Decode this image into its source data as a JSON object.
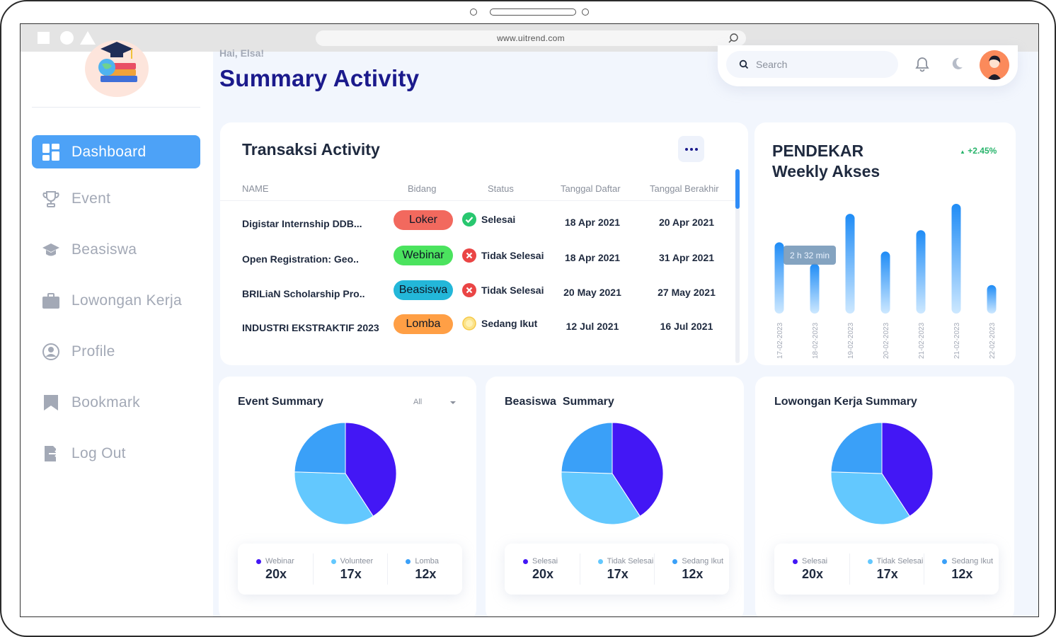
{
  "browser": {
    "url": "www.uitrend.com"
  },
  "sidebar": {
    "items": [
      {
        "label": "Dashboard",
        "icon": "dashboard-icon",
        "active": true
      },
      {
        "label": "Event",
        "icon": "trophy-icon"
      },
      {
        "label": "Beasiswa",
        "icon": "graduation-cap-icon"
      },
      {
        "label": "Lowongan Kerja",
        "icon": "briefcase-icon"
      },
      {
        "label": "Profile",
        "icon": "user-circle-icon"
      },
      {
        "label": "Bookmark",
        "icon": "bookmark-icon"
      },
      {
        "label": "Log Out",
        "icon": "logout-icon"
      }
    ]
  },
  "header": {
    "greeting": "Hai, Elsa!",
    "title": "Summary Activity",
    "search_placeholder": "Search"
  },
  "transactions": {
    "title": "Transaksi Activity",
    "columns": [
      "NAME",
      "Bidang",
      "Status",
      "Tanggal Daftar",
      "Tanggal Berakhir"
    ],
    "rows": [
      {
        "name": "Digistar Internship DDB...",
        "bidang": "Loker",
        "bidang_color": "#f2695e",
        "status": "Selesai",
        "status_type": "done",
        "daftar": "18 Apr 2021",
        "berakhir": "20 Apr 2021"
      },
      {
        "name": "Open Registration: Geo..",
        "bidang": "Webinar",
        "bidang_color": "#4be35e",
        "status": "Tidak Selesai",
        "status_type": "fail",
        "daftar": "18 Apr 2021",
        "berakhir": "31 Apr 2021"
      },
      {
        "name": "BRILiaN Scholarship Pro..",
        "bidang": "Beasiswa",
        "bidang_color": "#23b7d9",
        "status": "Tidak Selesai",
        "status_type": "fail",
        "daftar": "20 May 2021",
        "berakhir": "27 May 2021"
      },
      {
        "name": "INDUSTRI EKSTRAKTIF 2023",
        "bidang": "Lomba",
        "bidang_color": "#ff9f45",
        "status": "Sedang Ikut",
        "status_type": "ongoing",
        "daftar": "12 Jul 2021",
        "berakhir": "16 Jul 2021"
      }
    ]
  },
  "weekly": {
    "title_line1": "PENDEKAR",
    "title_line2": "Weekly Akses",
    "delta": "+2.45%",
    "tooltip": "2 h 32 min",
    "chart_data": {
      "type": "bar",
      "categories": [
        "17-02-2023",
        "18-02-2023",
        "19-02-2023",
        "20-02-2023",
        "21-02-2023",
        "21-02-2023",
        "22-02-2023"
      ],
      "values": [
        100,
        70,
        140,
        87,
        117,
        154,
        40
      ]
    }
  },
  "summaries": [
    {
      "title": "Event Summary",
      "filter": "All",
      "chart_data": {
        "type": "pie",
        "labels": [
          "Webinar",
          "Volunteer",
          "Lomba"
        ],
        "values": [
          20,
          17,
          12
        ],
        "colors": [
          "#4317f5",
          "#63c8fe",
          "#3aa0f8"
        ]
      },
      "legend": [
        {
          "label": "Webinar",
          "value": "20x"
        },
        {
          "label": "Volunteer",
          "value": "17x"
        },
        {
          "label": "Lomba",
          "value": "12x"
        }
      ]
    },
    {
      "title": "Beasiswa  Summary",
      "chart_data": {
        "type": "pie",
        "labels": [
          "Selesai",
          "Tidak Selesai",
          "Sedang Ikut"
        ],
        "values": [
          20,
          17,
          12
        ],
        "colors": [
          "#4317f5",
          "#63c8fe",
          "#3aa0f8"
        ]
      },
      "legend": [
        {
          "label": "Selesai",
          "value": "20x"
        },
        {
          "label": "Tidak Selesai",
          "value": "17x"
        },
        {
          "label": "Sedang Ikut",
          "value": "12x"
        }
      ]
    },
    {
      "title": "Lowongan Kerja Summary",
      "chart_data": {
        "type": "pie",
        "labels": [
          "Selesai",
          "Tidak Selesai",
          "Sedang Ikut"
        ],
        "values": [
          20,
          17,
          12
        ],
        "colors": [
          "#4317f5",
          "#63c8fe",
          "#3aa0f8"
        ]
      },
      "legend": [
        {
          "label": "Selesai",
          "value": "20x"
        },
        {
          "label": "Tidak Selesai",
          "value": "17x"
        },
        {
          "label": "Sedang Ikut",
          "value": "12x"
        }
      ]
    }
  ]
}
